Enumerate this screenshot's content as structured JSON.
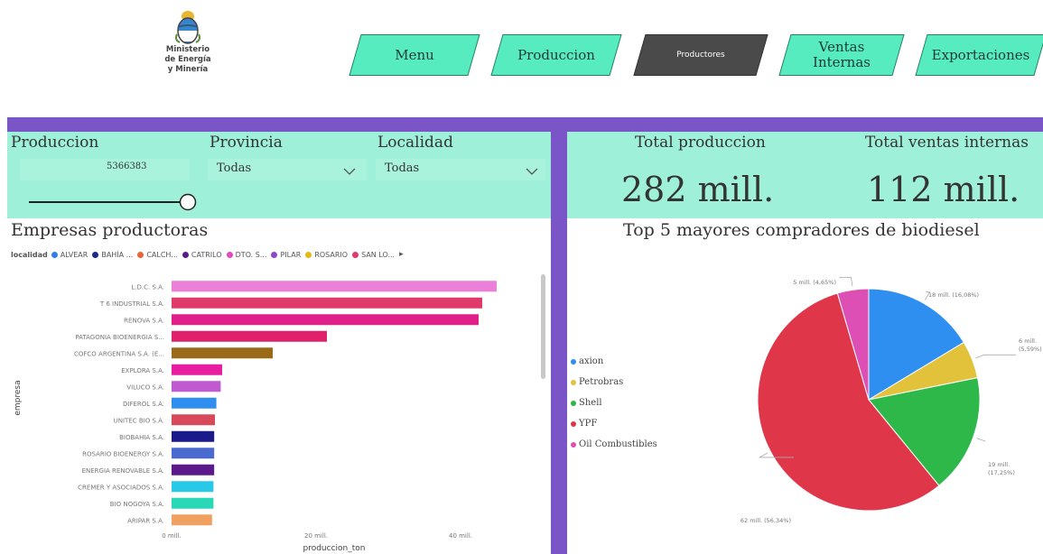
{
  "logo": {
    "lines": [
      "Ministerio",
      "de Energía",
      "y Minería"
    ]
  },
  "nav": [
    {
      "label": "Menu",
      "active": false
    },
    {
      "label": "Produccion",
      "active": false
    },
    {
      "label": "Productores",
      "active": true
    },
    {
      "label": "Ventas Internas",
      "active": false
    },
    {
      "label": "Exportaciones",
      "active": false
    }
  ],
  "filters": {
    "produccion": {
      "label": "Produccion",
      "value": "5366383"
    },
    "provincia": {
      "label": "Provincia",
      "value": "Todas"
    },
    "localidad": {
      "label": "Localidad",
      "value": "Todas"
    }
  },
  "kpis": {
    "total_produccion": {
      "label": "Total produccion",
      "value": "282 mill."
    },
    "total_ventas": {
      "label": "Total ventas internas",
      "value": "112 mill."
    }
  },
  "bar_chart": {
    "title": "Empresas productoras",
    "legend_title": "localidad",
    "legend": [
      {
        "name": "ALVEAR",
        "color": "#2f7fe8"
      },
      {
        "name": "BAHÍA ...",
        "color": "#1b2a8a"
      },
      {
        "name": "CALCH...",
        "color": "#e8663a"
      },
      {
        "name": "CATRILO",
        "color": "#5a1a8c"
      },
      {
        "name": "DTO. S...",
        "color": "#e34ac0"
      },
      {
        "name": "PILAR",
        "color": "#8a4ac8"
      },
      {
        "name": "ROSARIO",
        "color": "#e2b81a"
      },
      {
        "name": "SAN LO...",
        "color": "#e03a6a"
      }
    ],
    "y_axis_label": "empresa",
    "x_axis_label": "produccion_ton",
    "x_ticks": [
      "0 mill.",
      "20 mill.",
      "40 mill."
    ]
  },
  "pie_chart": {
    "title": "Top 5 mayores compradores de biodiesel",
    "labels": [
      "18 mill. (16,08%)",
      "6 mill. (5,59%)",
      "19 mill. (17,25%)",
      "62 mill. (56,34%)",
      "5 mill. (4,65%)"
    ]
  },
  "chart_data": [
    {
      "type": "bar",
      "title": "Empresas productoras",
      "xlabel": "produccion_ton",
      "ylabel": "empresa",
      "xlim": [
        0,
        50000000
      ],
      "categories": [
        "L.D.C. S.A.",
        "T 6 INDUSTRIAL S.A.",
        "RENOVA S.A.",
        "PATAGONIA BIOENERGIA S...",
        "COFCO ARGENTINA S.A. (E...",
        "EXPLORA S.A.",
        "VILUCO S.A.",
        "DIFEROL S.A.",
        "UNITEC BIO S.A.",
        "BIOBAHIA S.A.",
        "ROSARIO BIOENERGY S.A.",
        "ENERGIA RENOVABLE S.A.",
        "CREMER Y ASOCIADOS S.A.",
        "BIO NOGOYA S.A.",
        "ARIPAR S.A."
      ],
      "values": [
        45000000,
        43000000,
        42500000,
        21500000,
        14000000,
        7000000,
        6800000,
        6200000,
        6000000,
        5900000,
        5900000,
        5900000,
        5800000,
        5800000,
        5600000
      ],
      "colors": [
        "#ec7fd8",
        "#e03a6a",
        "#e0208a",
        "#e0206a",
        "#9a6a18",
        "#e81ea0",
        "#c05ad0",
        "#2f8ff0",
        "#d84a5a",
        "#1b1a8a",
        "#4a6ad0",
        "#5a1a8c",
        "#28c8e8",
        "#2ad8b8",
        "#f0a060"
      ]
    },
    {
      "type": "pie",
      "title": "Top 5 mayores compradores de biodiesel",
      "categories": [
        "axion",
        "Petrobras",
        "Shell",
        "YPF",
        "Oil Combustibles"
      ],
      "values": [
        18000000,
        6000000,
        19000000,
        62000000,
        5000000
      ],
      "percentages": [
        16.08,
        5.59,
        17.25,
        56.34,
        4.65
      ],
      "colors": [
        "#2f8ff0",
        "#e2c23a",
        "#2eb84a",
        "#e0364a",
        "#de4fb6"
      ],
      "legend": "left"
    }
  ]
}
